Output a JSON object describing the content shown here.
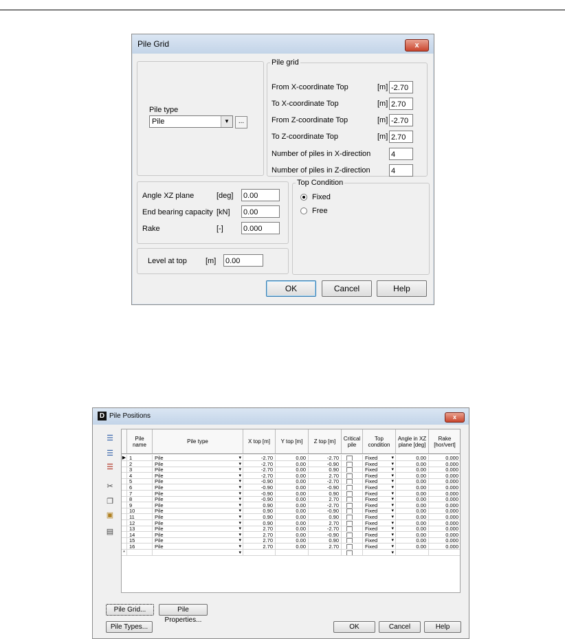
{
  "pile_grid_dialog": {
    "title": "Pile Grid",
    "close_label": "x",
    "pile_type_label": "Pile type",
    "pile_type_value": "Pile",
    "pile_type_browse": "...",
    "grid_group_title": "Pile grid",
    "grid_fields": [
      {
        "label": "From X-coordinate Top",
        "unit": "[m]",
        "value": "-2.70"
      },
      {
        "label": "To X-coordinate Top",
        "unit": "[m]",
        "value": "2.70"
      },
      {
        "label": "From Z-coordinate Top",
        "unit": "[m]",
        "value": "-2.70"
      },
      {
        "label": "To Z-coordinate Top",
        "unit": "[m]",
        "value": "2.70"
      },
      {
        "label": "Number of piles in X-direction",
        "unit": "",
        "value": "4"
      },
      {
        "label": "Number of piles in Z-direction",
        "unit": "",
        "value": "4"
      }
    ],
    "props": [
      {
        "label": "Angle XZ plane",
        "unit": "[deg]",
        "value": "0.00"
      },
      {
        "label": "End bearing capacity",
        "unit": "[kN]",
        "value": "0.00"
      },
      {
        "label": "Rake",
        "unit": "[-]",
        "value": "0.000"
      }
    ],
    "level_label": "Level at top",
    "level_unit": "[m]",
    "level_value": "0.00",
    "top_condition_title": "Top Condition",
    "top_condition_options": [
      "Fixed",
      "Free"
    ],
    "top_condition_selected": "Fixed",
    "ok_label": "OK",
    "cancel_label": "Cancel",
    "help_label": "Help"
  },
  "pile_positions_window": {
    "title": "Pile Positions",
    "app_icon": "D",
    "toolbar_icons": [
      "insert-row-icon",
      "add-row-icon",
      "delete-row-icon",
      "cut-icon",
      "copy-icon",
      "paste-icon",
      "paste-special-icon"
    ],
    "columns": [
      "Pile name",
      "Pile type",
      "X top [m]",
      "Y top [m]",
      "Z top [m]",
      "Critical pile",
      "Top condition",
      "Angle in XZ plane [deg]",
      "Rake [hor/vert]"
    ],
    "rows": [
      {
        "name": "1",
        "type": "Pile",
        "x": "-2.70",
        "y": "0.00",
        "z": "-2.70",
        "cond": "Fixed",
        "angle": "0.00",
        "rake": "0.000"
      },
      {
        "name": "2",
        "type": "Pile",
        "x": "-2.70",
        "y": "0.00",
        "z": "-0.90",
        "cond": "Fixed",
        "angle": "0.00",
        "rake": "0.000"
      },
      {
        "name": "3",
        "type": "Pile",
        "x": "-2.70",
        "y": "0.00",
        "z": "0.90",
        "cond": "Fixed",
        "angle": "0.00",
        "rake": "0.000"
      },
      {
        "name": "4",
        "type": "Pile",
        "x": "-2.70",
        "y": "0.00",
        "z": "2.70",
        "cond": "Fixed",
        "angle": "0.00",
        "rake": "0.000"
      },
      {
        "name": "5",
        "type": "Pile",
        "x": "-0.90",
        "y": "0.00",
        "z": "-2.70",
        "cond": "Fixed",
        "angle": "0.00",
        "rake": "0.000"
      },
      {
        "name": "6",
        "type": "Pile",
        "x": "-0.90",
        "y": "0.00",
        "z": "-0.90",
        "cond": "Fixed",
        "angle": "0.00",
        "rake": "0.000"
      },
      {
        "name": "7",
        "type": "Pile",
        "x": "-0.90",
        "y": "0.00",
        "z": "0.90",
        "cond": "Fixed",
        "angle": "0.00",
        "rake": "0.000"
      },
      {
        "name": "8",
        "type": "Pile",
        "x": "-0.90",
        "y": "0.00",
        "z": "2.70",
        "cond": "Fixed",
        "angle": "0.00",
        "rake": "0.000"
      },
      {
        "name": "9",
        "type": "Pile",
        "x": "0.90",
        "y": "0.00",
        "z": "-2.70",
        "cond": "Fixed",
        "angle": "0.00",
        "rake": "0.000"
      },
      {
        "name": "10",
        "type": "Pile",
        "x": "0.90",
        "y": "0.00",
        "z": "-0.90",
        "cond": "Fixed",
        "angle": "0.00",
        "rake": "0.000"
      },
      {
        "name": "11",
        "type": "Pile",
        "x": "0.90",
        "y": "0.00",
        "z": "0.90",
        "cond": "Fixed",
        "angle": "0.00",
        "rake": "0.000"
      },
      {
        "name": "12",
        "type": "Pile",
        "x": "0.90",
        "y": "0.00",
        "z": "2.70",
        "cond": "Fixed",
        "angle": "0.00",
        "rake": "0.000"
      },
      {
        "name": "13",
        "type": "Pile",
        "x": "2.70",
        "y": "0.00",
        "z": "-2.70",
        "cond": "Fixed",
        "angle": "0.00",
        "rake": "0.000"
      },
      {
        "name": "14",
        "type": "Pile",
        "x": "2.70",
        "y": "0.00",
        "z": "-0.90",
        "cond": "Fixed",
        "angle": "0.00",
        "rake": "0.000"
      },
      {
        "name": "15",
        "type": "Pile",
        "x": "2.70",
        "y": "0.00",
        "z": "0.90",
        "cond": "Fixed",
        "angle": "0.00",
        "rake": "0.000"
      },
      {
        "name": "16",
        "type": "Pile",
        "x": "2.70",
        "y": "0.00",
        "z": "2.70",
        "cond": "Fixed",
        "angle": "0.00",
        "rake": "0.000"
      }
    ],
    "new_row_marker": "*",
    "current_row_marker": "▶",
    "pile_grid_button": "Pile Grid...",
    "pile_properties_button": "Pile Properties...",
    "pile_types_button": "Pile Types...",
    "ok_label": "OK",
    "cancel_label": "Cancel",
    "help_label": "Help"
  }
}
